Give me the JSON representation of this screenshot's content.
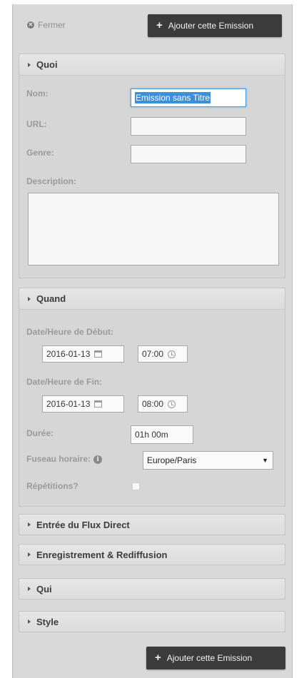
{
  "topbar": {
    "close_label": "Fermer",
    "add_label": "Ajouter cette Emission"
  },
  "quoi": {
    "title": "Quoi",
    "name_label": "Nom:",
    "name_value": "Emission sans Titre",
    "url_label": "URL:",
    "url_value": "",
    "genre_label": "Genre:",
    "genre_value": "",
    "description_label": "Description:",
    "description_value": ""
  },
  "quand": {
    "title": "Quand",
    "start_label": "Date/Heure de Début:",
    "start_date": "2016-01-13",
    "start_time": "07:00",
    "end_label": "Date/Heure de Fin:",
    "end_date": "2016-01-13",
    "end_time": "08:00",
    "duration_label": "Durée:",
    "duration_value": "01h 00m",
    "timezone_label": "Fuseau horaire:",
    "timezone_value": "Europe/Paris",
    "repeat_label": "Répétitions?"
  },
  "collapsed_sections": [
    "Entrée du Flux Direct",
    "Enregistrement & Rediffusion",
    "Qui",
    "Style"
  ],
  "bottom": {
    "add_label": "Ajouter cette Emission"
  }
}
